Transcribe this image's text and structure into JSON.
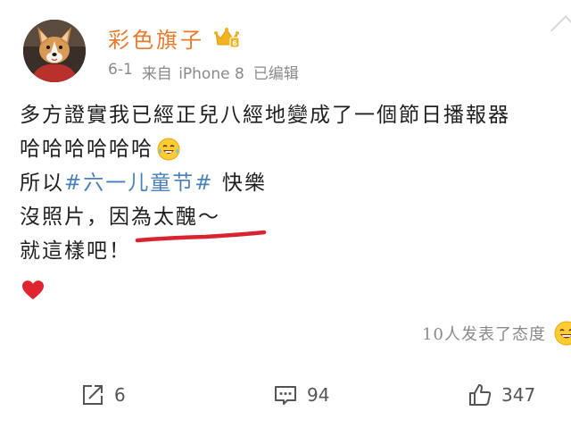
{
  "author": {
    "name": "彩色旗子"
  },
  "meta": {
    "date": "6-1",
    "source_prefix": "来自",
    "device": "iPhone 8",
    "edited": "已编辑"
  },
  "post": {
    "line1": "多方證實我已經正兒八經地變成了一個節日播報器",
    "line2": "哈哈哈哈哈哈",
    "line3_prefix": "所以",
    "line3_hashtag": "#六一儿童节#",
    "line3_suffix": " 快樂",
    "line4": "沒照片，因為太醜～",
    "line5": "就這樣吧！"
  },
  "reactions": {
    "text": "10人发表了态度"
  },
  "actions": {
    "share_count": "6",
    "comment_count": "94",
    "like_count": "347"
  },
  "colors": {
    "author_name": "#e77a2c",
    "hashtag": "#4a80b8",
    "underline_stroke": "#d9232f",
    "heart": "#e0242f"
  },
  "icons": {
    "crown": "crown-icon",
    "laugh_emoji": "laughing-tears-emoji-icon",
    "heart": "red-heart-icon",
    "share": "share-icon",
    "comment": "comment-icon",
    "like": "thumbs-up-icon"
  }
}
